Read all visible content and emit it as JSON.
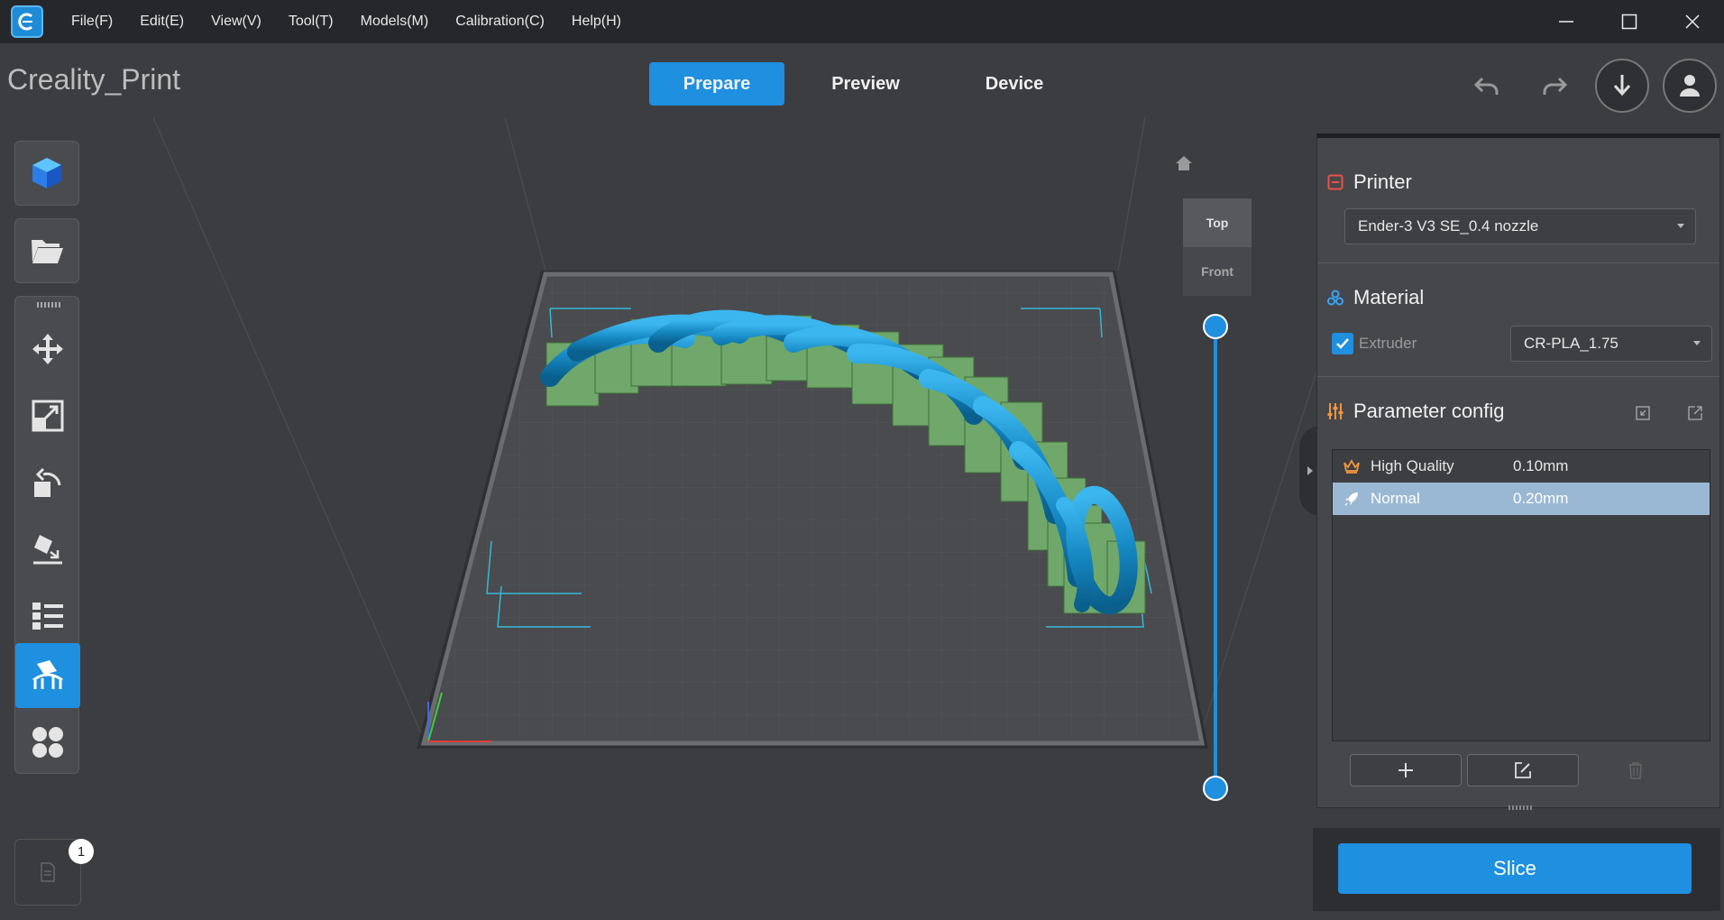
{
  "app": {
    "project_name": "Creality_Print"
  },
  "menu": [
    {
      "label": "File(F)"
    },
    {
      "label": "Edit(E)"
    },
    {
      "label": "View(V)"
    },
    {
      "label": "Tool(T)"
    },
    {
      "label": "Models(M)"
    },
    {
      "label": "Calibration(C)"
    },
    {
      "label": "Help(H)"
    }
  ],
  "main_tabs": [
    {
      "label": "Prepare",
      "active": true
    },
    {
      "label": "Preview",
      "active": false
    },
    {
      "label": "Device",
      "active": false
    }
  ],
  "view_cube": {
    "top_label": "Top",
    "front_label": "Front"
  },
  "left_toolbar": {
    "active_tool": "support-tool",
    "page_badge": "1"
  },
  "panel": {
    "printer": {
      "title": "Printer",
      "selected": "Ender-3 V3 SE_0.4 nozzle"
    },
    "material": {
      "title": "Material",
      "extruder_label": "Extruder",
      "extruder_checked": true,
      "selected": "CR-PLA_1.75"
    },
    "parameter_config": {
      "title": "Parameter config",
      "profiles": [
        {
          "name": "High Quality",
          "value": "0.10mm",
          "icon": "crown-icon",
          "selected": false
        },
        {
          "name": "Normal",
          "value": "0.20mm",
          "icon": "rocket-icon",
          "selected": true
        }
      ]
    }
  },
  "slice": {
    "label": "Slice"
  },
  "colors": {
    "accent": "#1f8fdf",
    "model": "#1a8fc8",
    "support": "#6fa86a",
    "plate": "#4a4b4e"
  }
}
